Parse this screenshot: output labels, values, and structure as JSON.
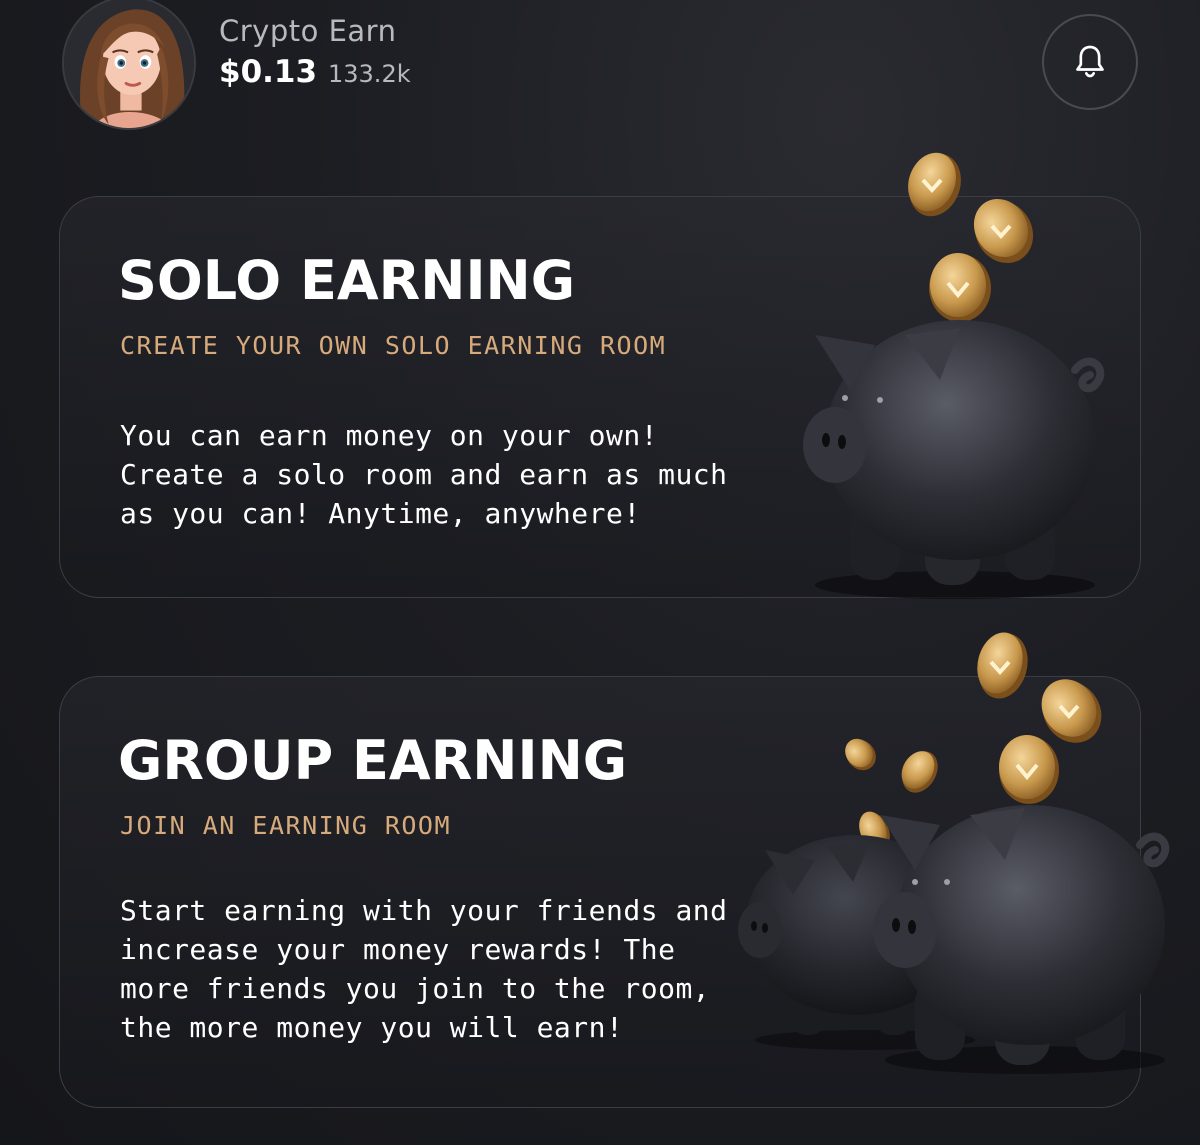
{
  "header": {
    "app_name": "Crypto Earn",
    "balance": "$0.13",
    "points": "133.2k",
    "avatar_icon": "avatar-girl",
    "notification_icon": "bell-icon"
  },
  "cards": [
    {
      "title": "SOLO EARNING",
      "subtitle": "CREATE YOUR OWN SOLO EARNING ROOM",
      "description": "You can earn money on your own! Create a solo room and earn as much as you can! Anytime, anywhere!",
      "illustration": "piggy-bank-with-coins"
    },
    {
      "title": "GROUP EARNING",
      "subtitle": "JOIN AN EARNING ROOM",
      "description": "Start earning with your friends and increase your money rewards! The more friends you join to the room, the more money you will earn!",
      "illustration": "two-piggy-banks-with-coins"
    }
  ],
  "colors": {
    "background": "#1c1d22",
    "accent": "#d7aa7c",
    "text_primary": "#ffffff",
    "text_secondary": "#b8b9be",
    "card_border": "#3c3d44",
    "coin_gold": "#c99a4e"
  }
}
